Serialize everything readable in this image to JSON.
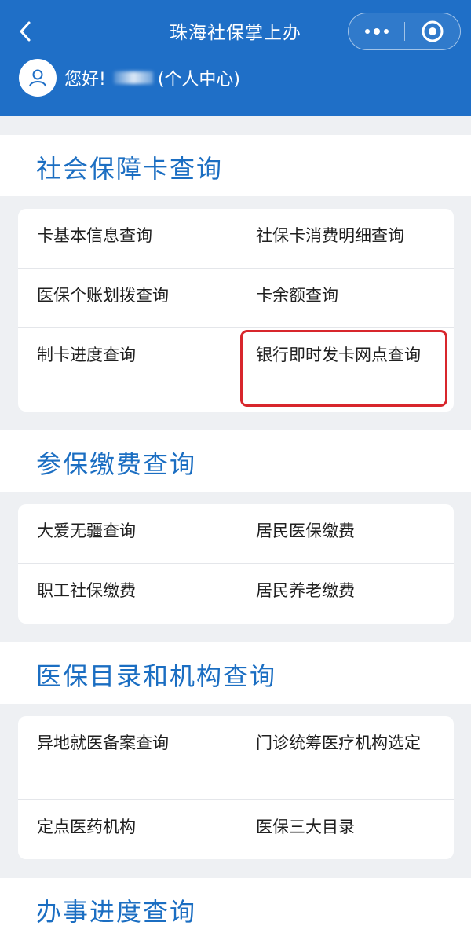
{
  "header": {
    "title": "珠海社保掌上办",
    "greeting": "您好!",
    "personal_center": "(个人中心)",
    "icons": {
      "back": "back-arrow-icon",
      "more": "more-dots-icon",
      "close": "close-circle-icon",
      "avatar": "user-avatar-icon"
    }
  },
  "sections": [
    {
      "title": "社会保障卡查询",
      "items": [
        "卡基本信息查询",
        "社保卡消费明细查询",
        "医保个账划拨查询",
        "卡余额查询",
        "制卡进度查询",
        "银行即时发卡网点查询"
      ]
    },
    {
      "title": "参保缴费查询",
      "items": [
        "大爱无疆查询",
        "居民医保缴费",
        "职工社保缴费",
        "居民养老缴费"
      ]
    },
    {
      "title": "医保目录和机构查询",
      "items": [
        "异地就医备案查询",
        "门诊统筹医疗机构选定",
        "定点医药机构",
        "医保三大目录"
      ]
    },
    {
      "title": "办事进度查询"
    }
  ],
  "colors": {
    "header_bg": "#1f6fc7",
    "section_title": "#1b6ec2",
    "highlight": "#d8262c",
    "page_bg": "#eef0f3"
  }
}
